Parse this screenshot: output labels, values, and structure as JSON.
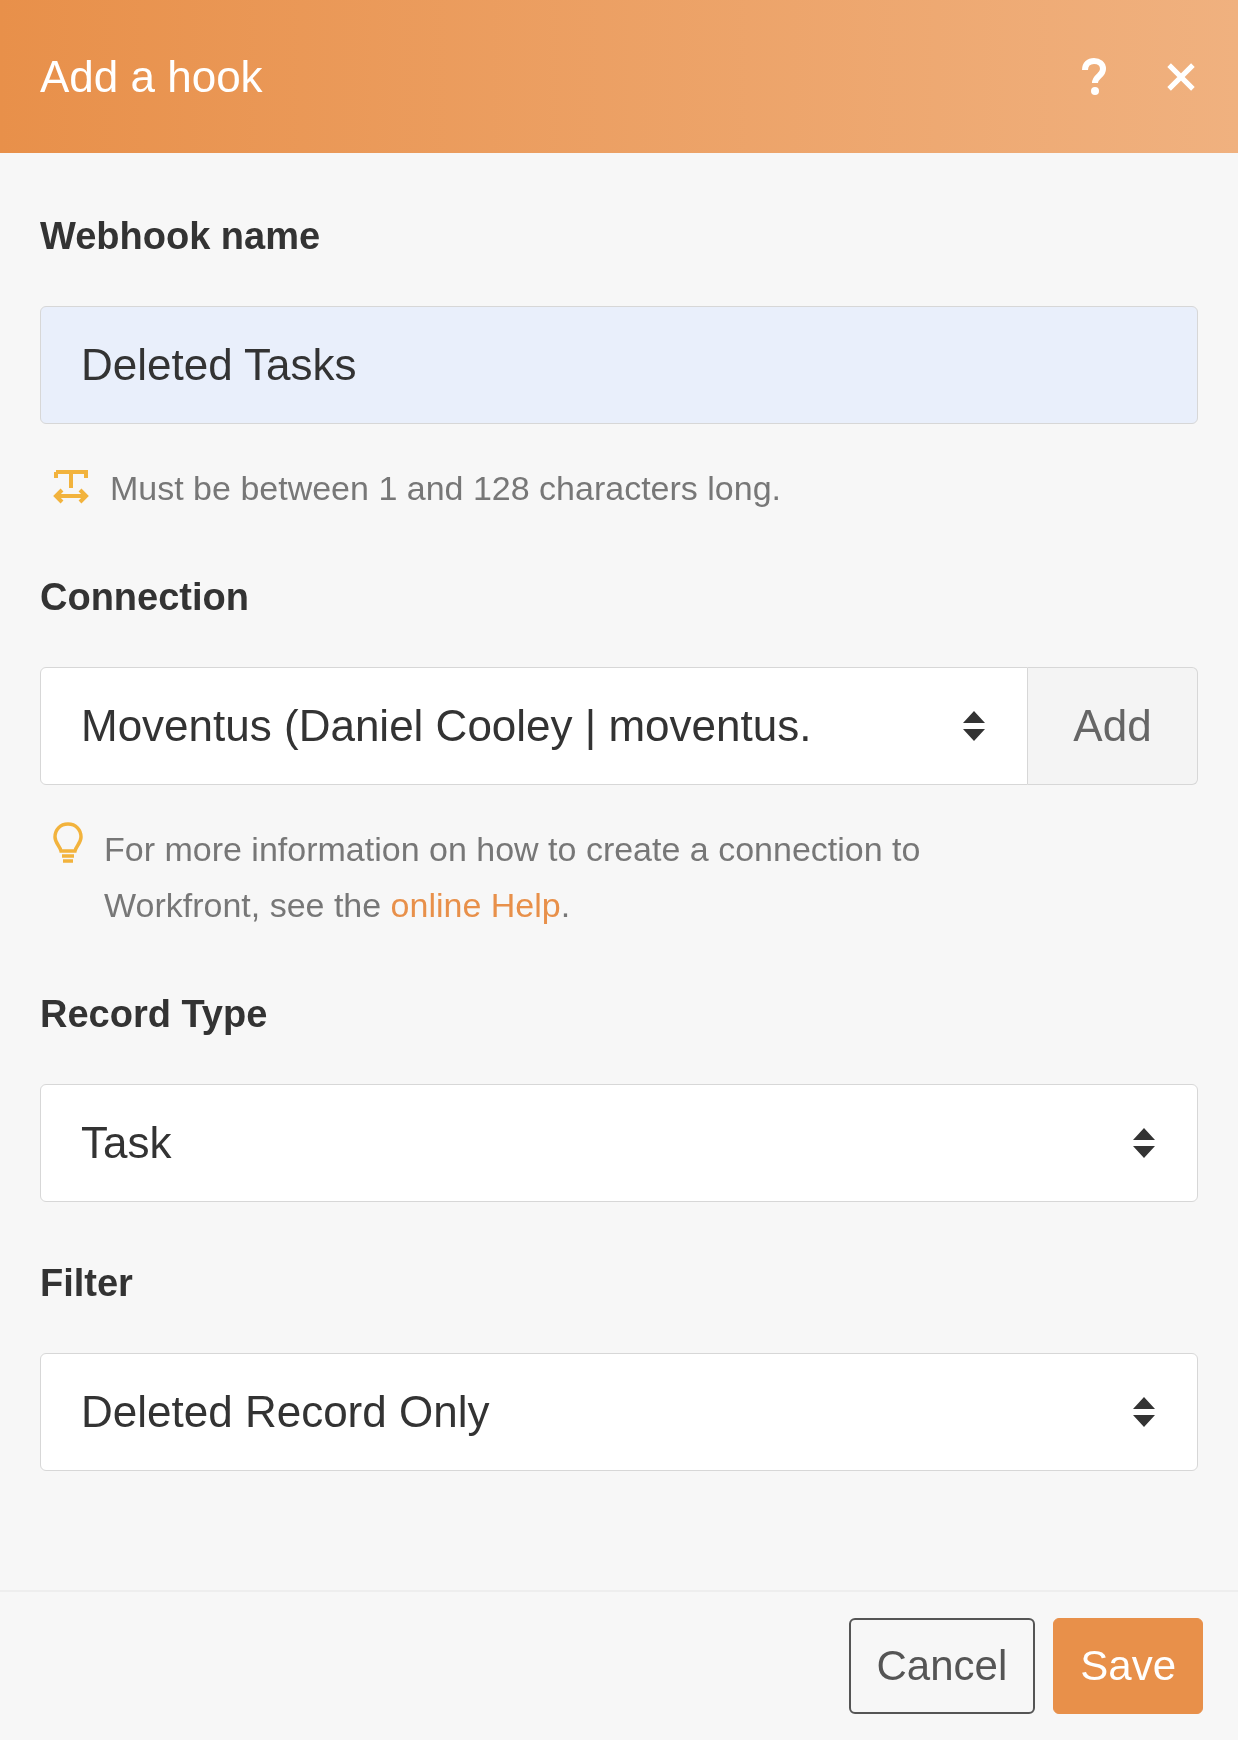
{
  "dialog": {
    "title": "Add a hook"
  },
  "fields": [
    {
      "kind": "text",
      "label": "Webhook name",
      "value": "Deleted Tasks",
      "focused": true,
      "hint": {
        "kind": "rule",
        "text": "Must be between 1 and 128 characters long."
      }
    },
    {
      "kind": "select",
      "label": "Connection",
      "value": "Moventus (Daniel Cooley | moventus.",
      "addon": "Add",
      "hint": {
        "kind": "tip",
        "text": "For more information on how to create a connection to Workfront, see the ",
        "link": "online Help",
        "after": "."
      }
    },
    {
      "kind": "select",
      "label": "Record Type",
      "value": "Task"
    },
    {
      "kind": "select",
      "label": "Filter",
      "value": "Deleted Record Only"
    }
  ],
  "buttons": [
    {
      "label": "Cancel",
      "primary": false
    },
    {
      "label": "Save",
      "primary": true
    }
  ]
}
